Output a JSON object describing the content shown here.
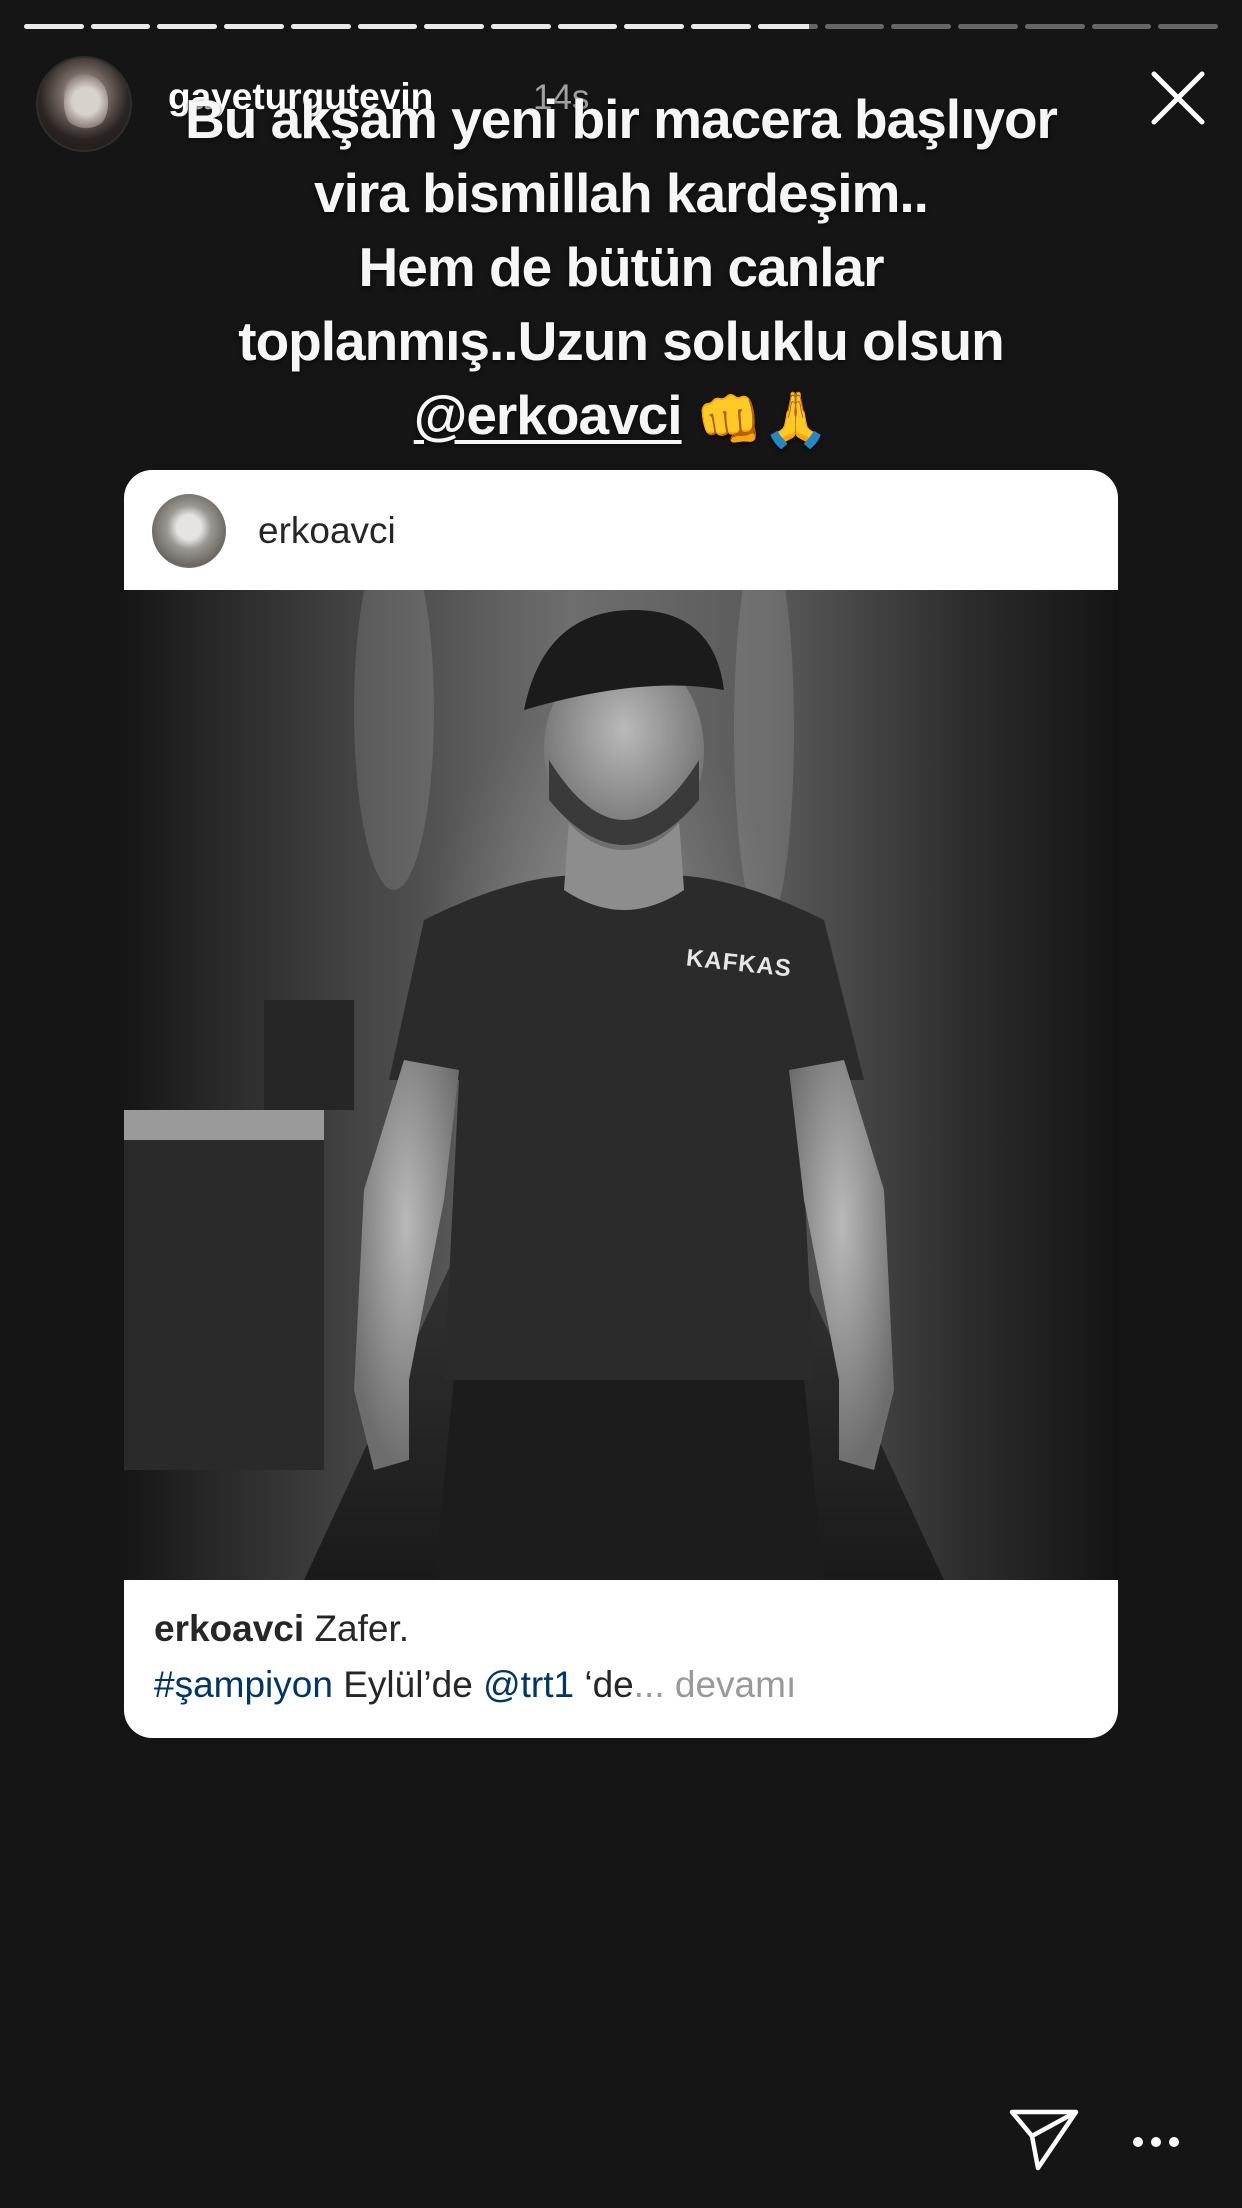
{
  "story": {
    "username": "gayeturgutevin",
    "time": "14s",
    "progress": {
      "total_segments": 18,
      "completed_segments": 11,
      "current_segment_fraction": 0.85
    }
  },
  "caption": {
    "line1": "Bu akşam yeni bir macera başlıyor",
    "line2": "vira bismillah kardeşim..",
    "line3": "Hem de bütün canlar",
    "line4": "toplanmış..Uzun soluklu olsun",
    "mention": "@erkoavci",
    "emojis": "👊🙏"
  },
  "post": {
    "username": "erkoavci",
    "shirt_text": "KAFKAS",
    "caption_user": "erkoavci",
    "caption_text": "Zafer.",
    "hashtag": "#şampiyon",
    "text_mid": " Eylül’de ",
    "mention": "@trt1",
    "text_end": " ‘de",
    "ellipsis": "...",
    "more_label": " devamı"
  },
  "icons": {
    "close": "close-icon",
    "share": "send-icon",
    "more": "more-icon"
  },
  "colors": {
    "background": "#151516",
    "link": "#003569",
    "muted": "#999999"
  }
}
